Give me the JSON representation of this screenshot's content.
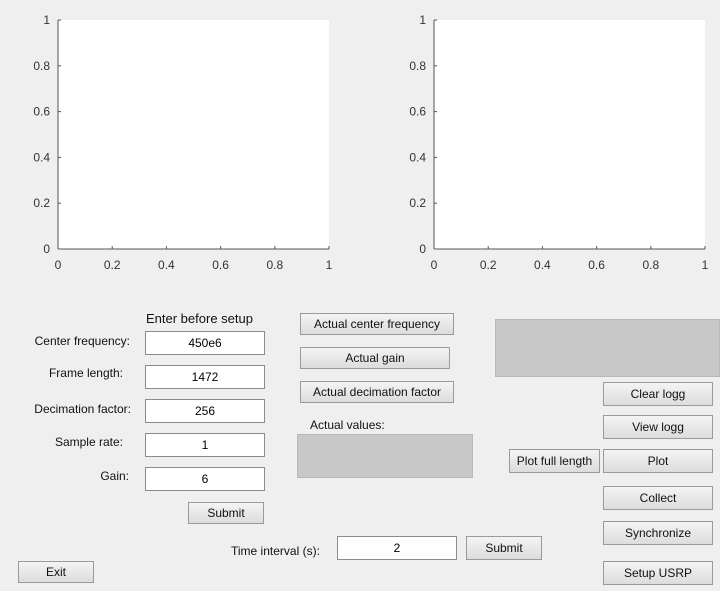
{
  "plots": [
    {
      "name": "left-plot",
      "xlim": [
        0,
        1
      ],
      "ylim": [
        0,
        1
      ],
      "x_ticks": [
        "0",
        "0.2",
        "0.4",
        "0.6",
        "0.8",
        "1"
      ],
      "y_ticks": [
        "0",
        "0.2",
        "0.4",
        "0.6",
        "0.8",
        "1"
      ]
    },
    {
      "name": "right-plot",
      "xlim": [
        0,
        1
      ],
      "ylim": [
        0,
        1
      ],
      "x_ticks": [
        "0",
        "0.2",
        "0.4",
        "0.6",
        "0.8",
        "1"
      ],
      "y_ticks": [
        "0",
        "0.2",
        "0.4",
        "0.6",
        "0.8",
        "1"
      ]
    }
  ],
  "setup": {
    "heading": "Enter before setup",
    "center_frequency": {
      "label": "Center frequency:",
      "value": "450e6"
    },
    "frame_length": {
      "label": "Frame length:",
      "value": "1472"
    },
    "decimation_factor": {
      "label": "Decimation factor:",
      "value": "256"
    },
    "sample_rate": {
      "label": "Sample rate:",
      "value": "1"
    },
    "gain": {
      "label": "Gain:",
      "value": "6"
    },
    "submit_label": "Submit"
  },
  "actual": {
    "center_frequency_label": "Actual center frequency",
    "gain_label": "Actual gain",
    "decimation_factor_label": "Actual decimation factor",
    "values_label": "Actual values:"
  },
  "controls": {
    "clear_logg": "Clear logg",
    "view_logg": "View logg",
    "plot_full_length": "Plot full length",
    "plot": "Plot",
    "collect": "Collect",
    "synchronize": "Synchronize",
    "setup_usrp": "Setup USRP"
  },
  "time_interval": {
    "label": "Time interval (s):",
    "value": "2",
    "submit_label": "Submit"
  },
  "exit_label": "Exit"
}
